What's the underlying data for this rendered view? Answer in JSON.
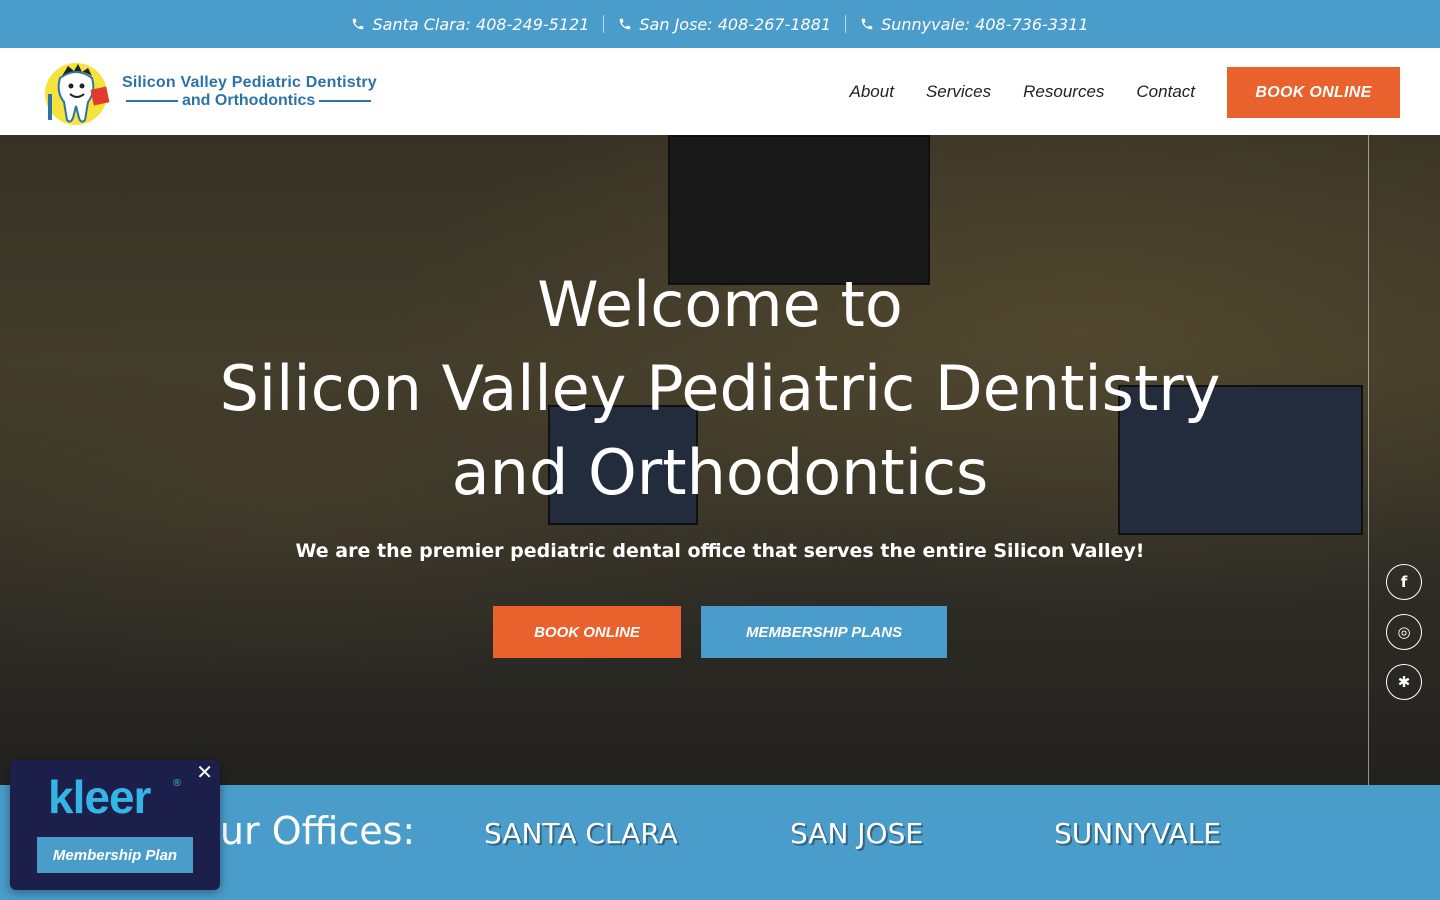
{
  "topbar": {
    "phones": [
      {
        "label": "Santa Clara: 408-249-5121",
        "icon": "phone-icon"
      },
      {
        "label": "San Jose: 408-267-1881",
        "icon": "phone-icon"
      },
      {
        "label": "Sunnyvale: 408-736-3311",
        "icon": "phone-icon"
      }
    ]
  },
  "header": {
    "logo_line1": "Silicon Valley Pediatric Dentistry",
    "logo_line2": "and Orthodontics",
    "nav": [
      {
        "label": "About"
      },
      {
        "label": "Services"
      },
      {
        "label": "Resources"
      },
      {
        "label": "Contact"
      }
    ],
    "book_label": "BOOK ONLINE"
  },
  "hero": {
    "title_line1": "Welcome to",
    "title_line2": "Silicon Valley Pediatric Dentistry",
    "title_line3": "and Orthodontics",
    "subtitle": "We are the premier pediatric dental office that serves the entire Silicon Valley!",
    "book_label": "BOOK ONLINE",
    "membership_label": "MEMBERSHIP PLANS",
    "social": [
      {
        "icon": "facebook-icon",
        "glyph": "f"
      },
      {
        "icon": "instagram-icon",
        "glyph": "◎"
      },
      {
        "icon": "yelp-icon",
        "glyph": "✱"
      }
    ]
  },
  "offices": {
    "label": "Our Offices:",
    "cities": [
      "SANTA CLARA",
      "SAN JOSE",
      "SUNNYVALE"
    ]
  },
  "kleer": {
    "logo": "kleer",
    "reg": "®",
    "button": "Membership Plan",
    "close": "✕"
  },
  "colors": {
    "primary_blue": "#4a9ccb",
    "accent_orange": "#e9612c",
    "kleer_navy": "#1b1f4a"
  }
}
